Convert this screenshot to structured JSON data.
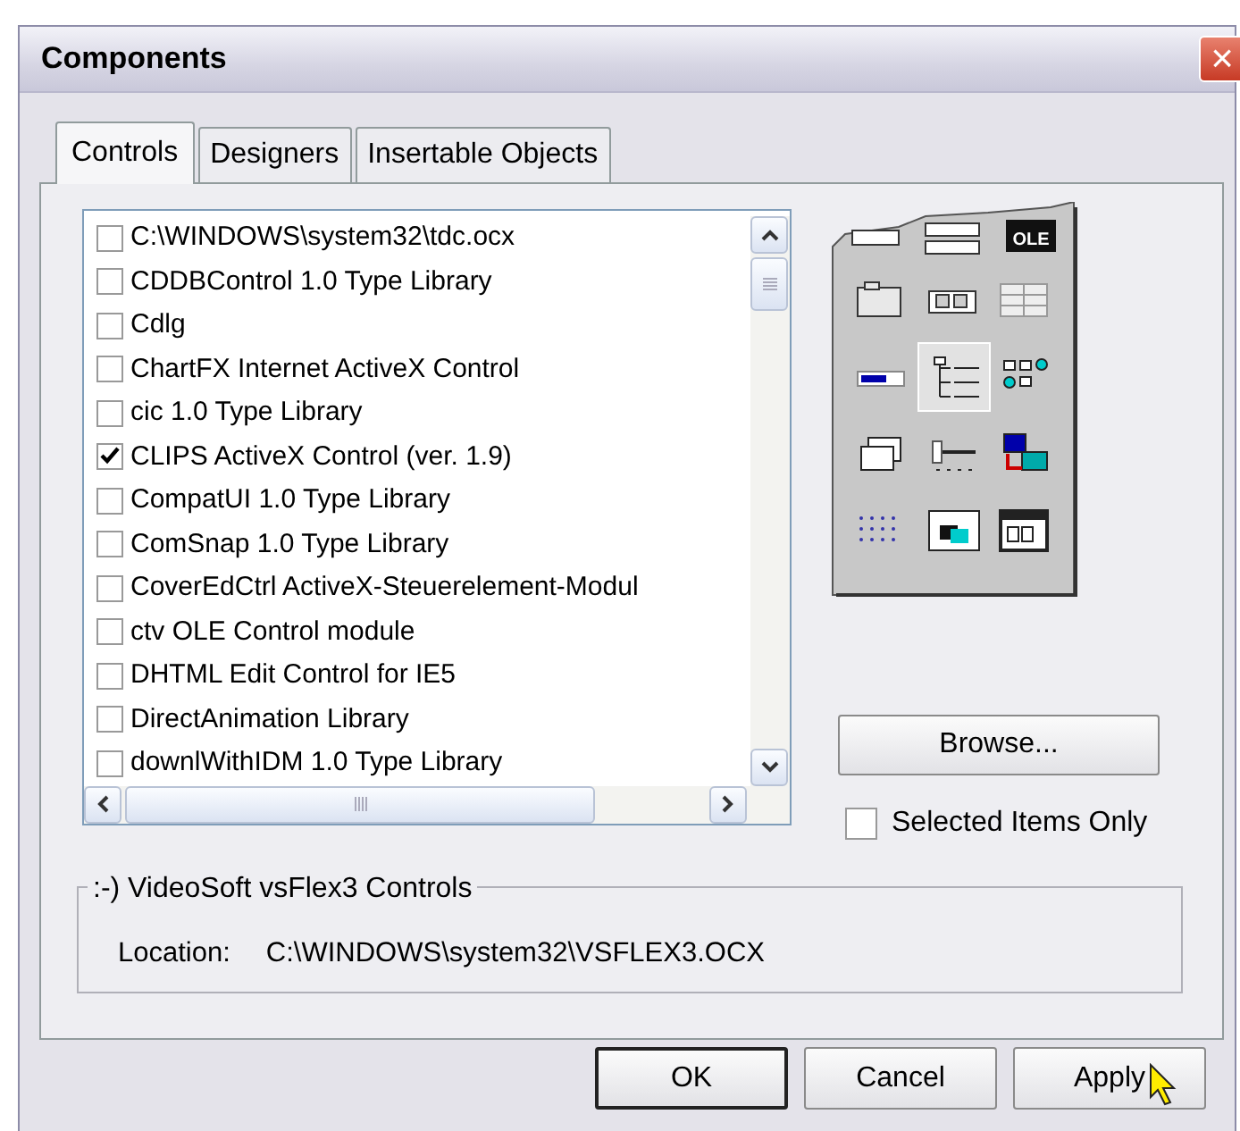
{
  "window": {
    "title": "Components",
    "close": "×"
  },
  "tabs": [
    {
      "label": "Controls",
      "selected": true
    },
    {
      "label": "Designers",
      "selected": false
    },
    {
      "label": "Insertable Objects",
      "selected": false
    }
  ],
  "list_items": [
    {
      "label": "C:\\WINDOWS\\system32\\tdc.ocx",
      "checked": false
    },
    {
      "label": "CDDBControl 1.0 Type Library",
      "checked": false
    },
    {
      "label": "Cdlg",
      "checked": false
    },
    {
      "label": "ChartFX Internet ActiveX Control",
      "checked": false
    },
    {
      "label": "cic 1.0 Type Library",
      "checked": false
    },
    {
      "label": "CLIPS ActiveX Control (ver. 1.9)",
      "checked": true
    },
    {
      "label": "CompatUI 1.0 Type Library",
      "checked": false
    },
    {
      "label": "ComSnap 1.0 Type Library",
      "checked": false
    },
    {
      "label": "CoverEdCtrl ActiveX-Steuerelement-Modul",
      "checked": false
    },
    {
      "label": "ctv OLE Control module",
      "checked": false
    },
    {
      "label": "DHTML Edit Control for IE5",
      "checked": false
    },
    {
      "label": "DirectAnimation Library",
      "checked": false
    },
    {
      "label": "downlWithIDM 1.0 Type Library",
      "checked": false
    }
  ],
  "toolbox": {
    "ole_label": "OLE",
    "tools": [
      {
        "kind": "folder",
        "selected": false
      },
      {
        "kind": "pair",
        "selected": false
      },
      {
        "kind": "grid",
        "selected": false
      },
      {
        "kind": "progress",
        "selected": false
      },
      {
        "kind": "tree",
        "selected": true
      },
      {
        "kind": "listview",
        "selected": false
      },
      {
        "kind": "stack",
        "selected": false
      },
      {
        "kind": "slider",
        "selected": false
      },
      {
        "kind": "network",
        "selected": false
      },
      {
        "kind": "dots",
        "selected": false
      },
      {
        "kind": "media",
        "selected": false
      },
      {
        "kind": "window",
        "selected": false
      }
    ]
  },
  "browse_button": "Browse...",
  "selected_only": {
    "label": "Selected Items Only",
    "checked": false
  },
  "details": {
    "title": ":-) VideoSoft vsFlex3 Controls",
    "location_label": "Location:",
    "location": "C:\\WINDOWS\\system32\\VSFLEX3.OCX"
  },
  "buttons": [
    {
      "label": "OK",
      "default": true
    },
    {
      "label": "Cancel",
      "default": false
    },
    {
      "label": "Apply",
      "default": false
    }
  ]
}
